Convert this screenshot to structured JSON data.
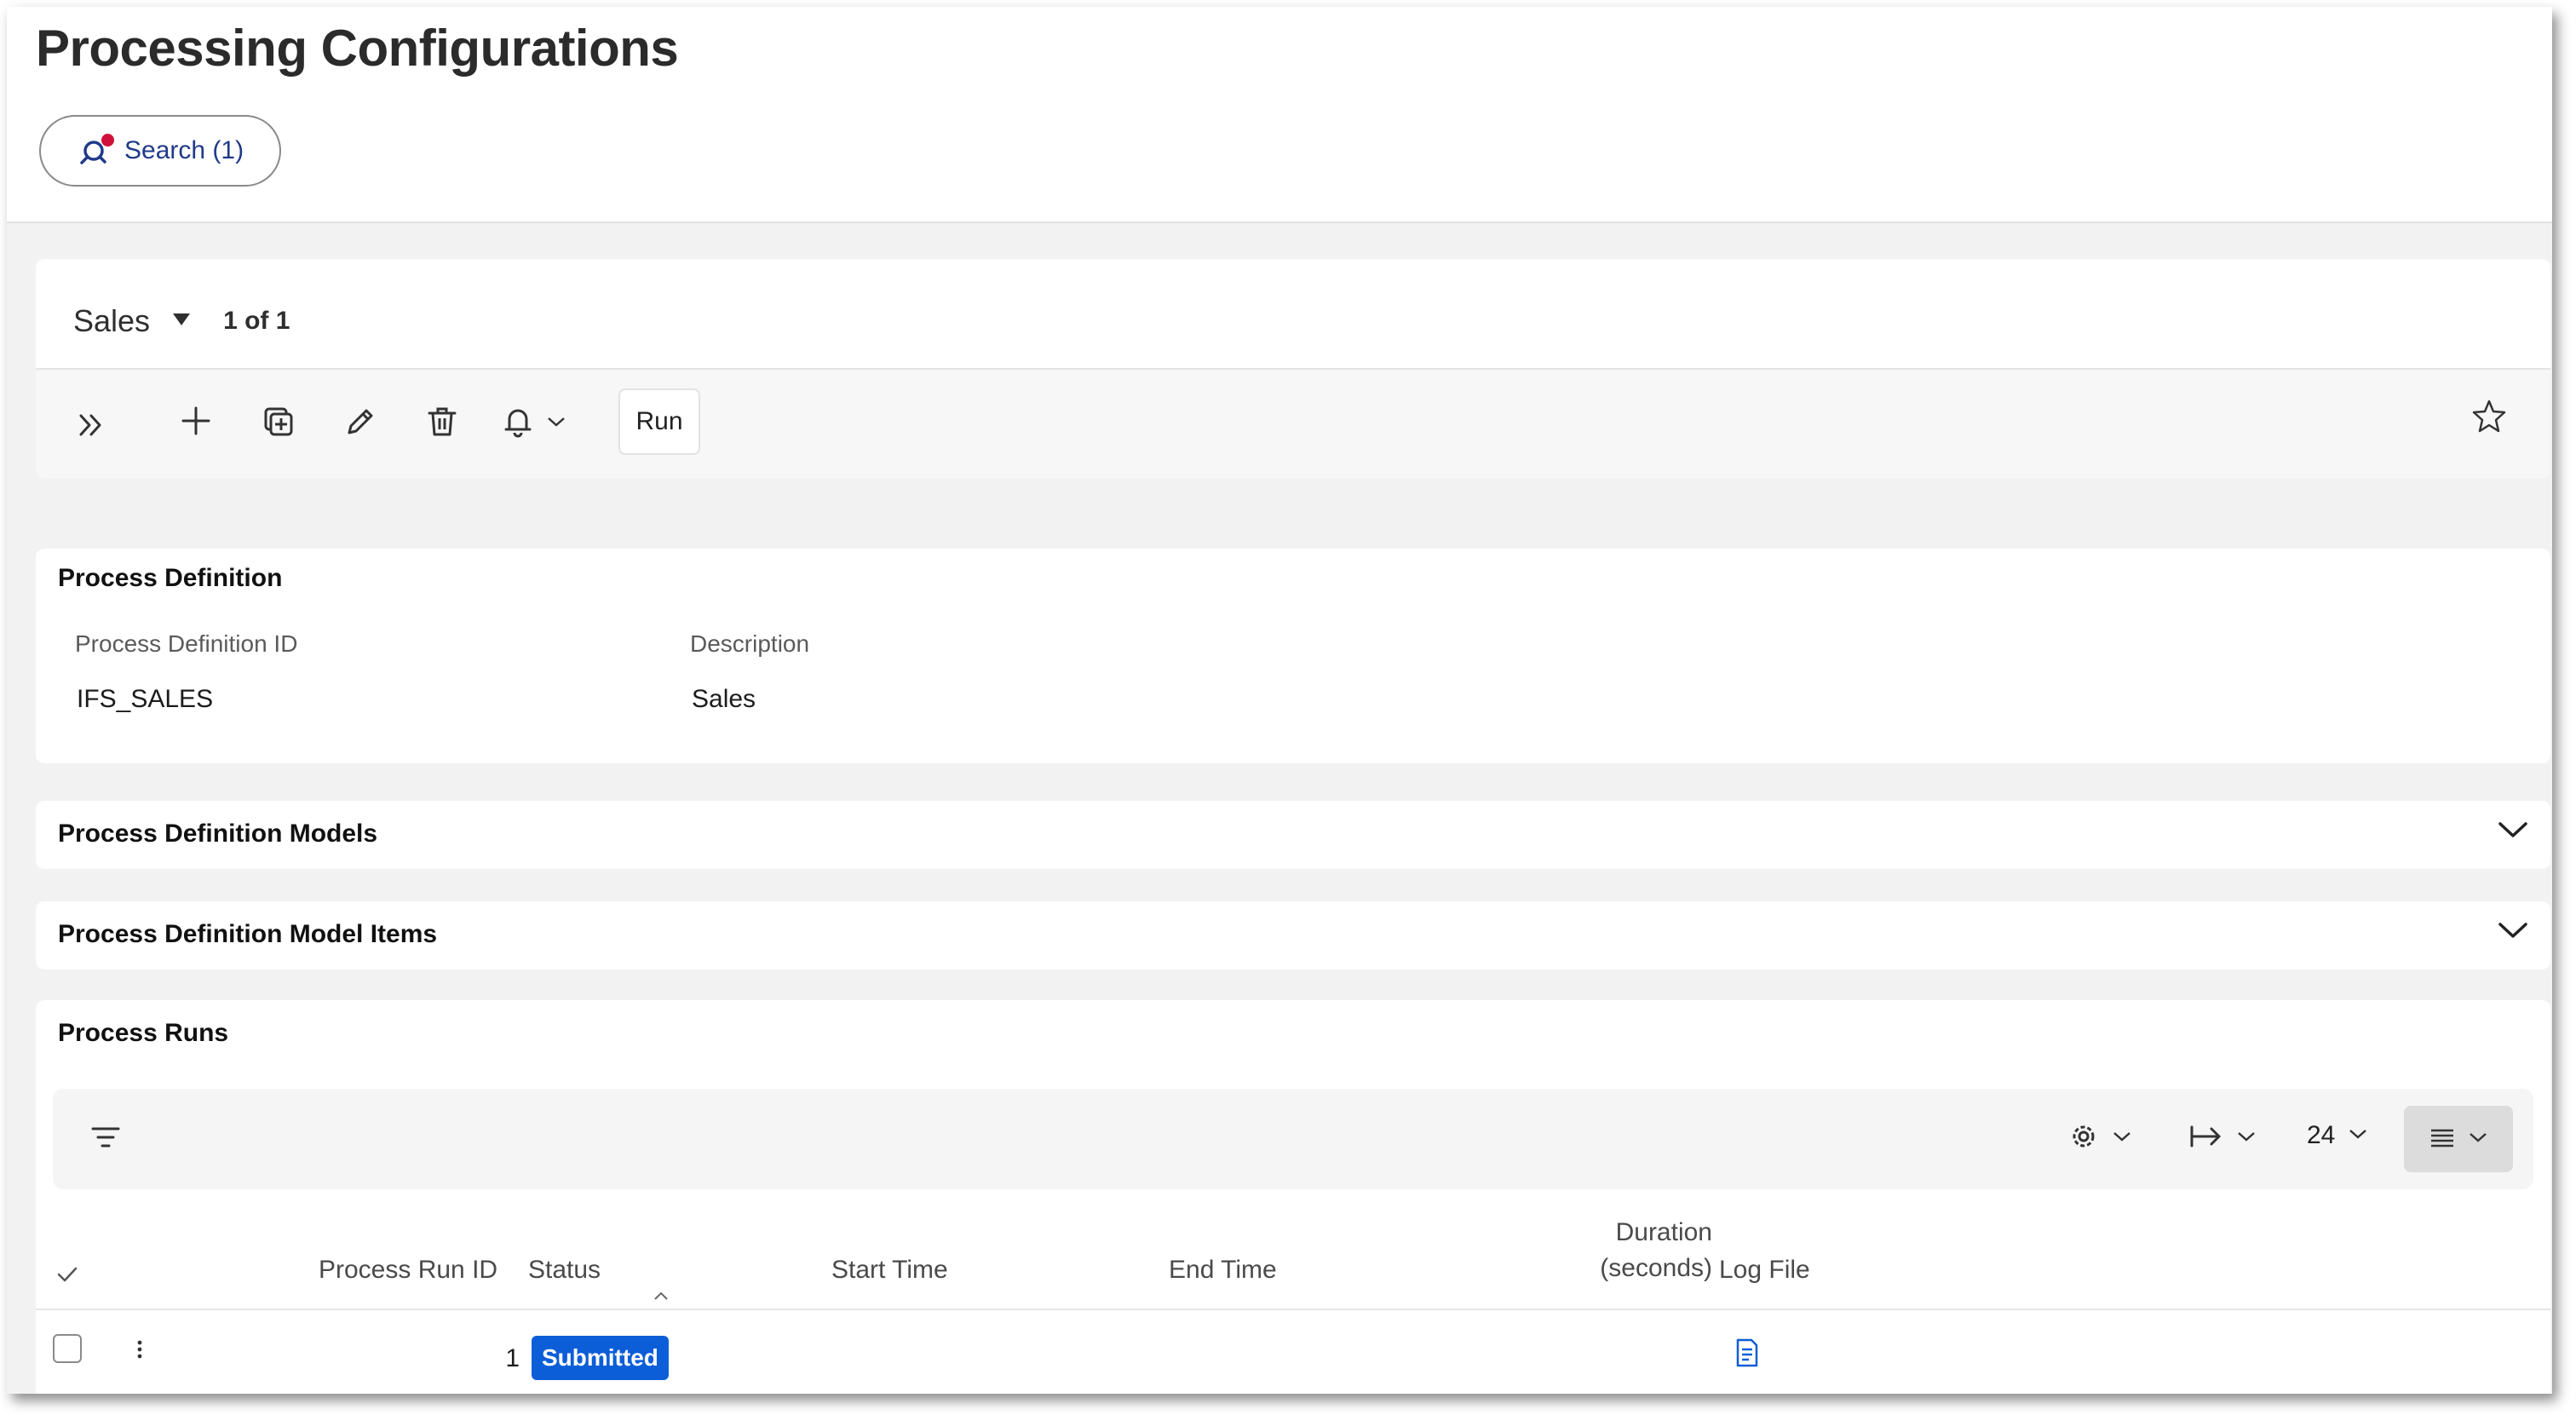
{
  "header": {
    "title": "Processing Configurations",
    "search_label": "Search (1)"
  },
  "record": {
    "selector_value": "Sales",
    "count_text": "1 of 1"
  },
  "toolbar": {
    "run_label": "Run"
  },
  "process_definition": {
    "title": "Process Definition",
    "fields": [
      {
        "label": "Process Definition ID",
        "value": "IFS_SALES"
      },
      {
        "label": "Description",
        "value": "Sales"
      }
    ]
  },
  "collapsed_sections": [
    {
      "title": "Process Definition Models"
    },
    {
      "title": "Process Definition Model Items"
    }
  ],
  "process_runs": {
    "title": "Process Runs",
    "page_size": "24",
    "columns": [
      {
        "label": "Process Run ID"
      },
      {
        "label": "Status"
      },
      {
        "label": "Start Time"
      },
      {
        "label": "End Time"
      },
      {
        "label": "Duration",
        "label2": "(seconds)"
      },
      {
        "label": "Log File"
      }
    ],
    "rows": [
      {
        "process_run_id": "1",
        "status": "Submitted",
        "start_time": "",
        "end_time": "",
        "duration": ""
      }
    ]
  },
  "colors": {
    "accent": "#0b5ed7",
    "search_text": "#1f3a8a",
    "notification_dot": "#d0103a"
  },
  "icons": [
    "search-icon",
    "caret-down-icon",
    "double-chevron-right-icon",
    "plus-icon",
    "duplicate-icon",
    "pencil-icon",
    "trash-icon",
    "bell-icon",
    "chevron-down-icon",
    "star-icon",
    "filter-icon",
    "gear-icon",
    "arrow-right-bar-icon",
    "list-view-icon",
    "kebab-icon",
    "log-file-icon",
    "check-icon",
    "sort-up-icon"
  ]
}
